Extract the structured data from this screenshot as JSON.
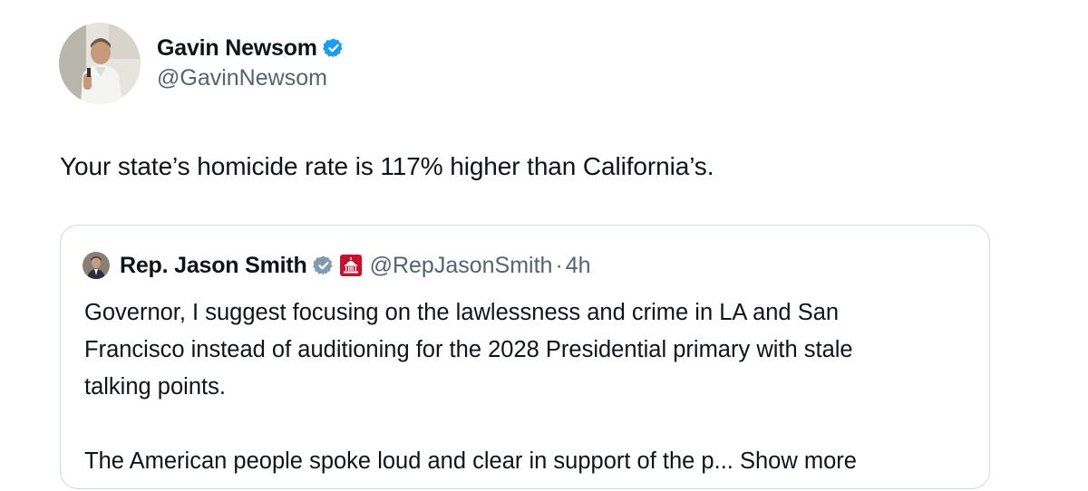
{
  "author": {
    "name": "Gavin Newsom",
    "handle": "@GavinNewsom",
    "verified_color": "#1d9bf0"
  },
  "tweet": {
    "text": "Your state’s homicide rate is 117% higher than California’s."
  },
  "quoted": {
    "name": "Rep. Jason Smith",
    "handle": "@RepJasonSmith",
    "separator": "·",
    "time": "4h",
    "badge_icon": "capitol-icon",
    "badge_color": "#c8102e",
    "paragraph1_lines": [
      "Governor, I suggest focusing on the lawlessness and crime in LA and San",
      "Francisco instead of auditioning for the 2028 Presidential primary with stale",
      "talking points."
    ],
    "paragraph2": "The American people spoke loud and clear in support of the p... ",
    "show_more": "Show more"
  }
}
